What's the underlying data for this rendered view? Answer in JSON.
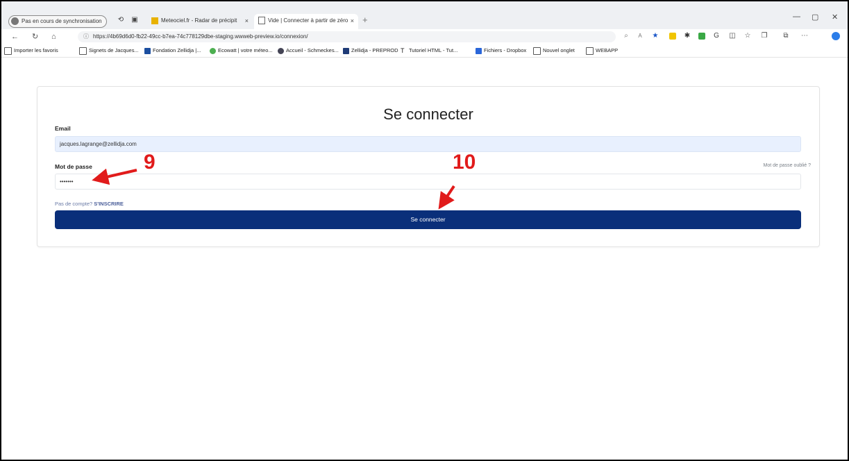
{
  "browser": {
    "profile_label": "Pas en cours de synchronisation",
    "tabs": [
      {
        "title": "Meteociel.fr - Radar de précipit",
        "active": false
      },
      {
        "title": "Vide | Connecter à partir de zéro",
        "active": true
      }
    ],
    "new_tab_symbol": "+",
    "close_symbol": "×",
    "window_controls": [
      "—",
      "▢",
      "✕"
    ],
    "url": "https://4b69d6d0-fb22-49cc-b7ea-74c778129dbe-staging.wwweb-preview.io/connexion/",
    "favorites": [
      {
        "label": "Importer les favoris",
        "icon": "import-icon"
      },
      {
        "label": "Signets de Jacques...",
        "icon": "page-icon"
      },
      {
        "label": "Fondation Zellidja |...",
        "icon": "site-icon"
      },
      {
        "label": "Ecowatt | votre méteo...",
        "icon": "ecowatt-icon"
      },
      {
        "label": "Accueil - Schmeckes...",
        "icon": "wordpress-icon"
      },
      {
        "label": "Zellidja - PREPROD",
        "icon": "zellidja-icon"
      },
      {
        "label": "Tutoriel HTML - Tut...",
        "icon": "tutorial-icon"
      },
      {
        "label": "Fichiers - Dropbox",
        "icon": "dropbox-icon"
      },
      {
        "label": "Nouvel onglet",
        "icon": "newtab-icon"
      },
      {
        "label": "WEBAPP",
        "icon": "page-icon"
      }
    ]
  },
  "login": {
    "title": "Se connecter",
    "email_label": "Email",
    "email_value": "jacques.lagrange@zellidja.com",
    "password_label": "Mot de passe",
    "password_value": "•••••••",
    "forgot_label": "Mot de passe oublié ?",
    "signup_prefix": "Pas de compte?",
    "signup_link": "S'INSCRIRE",
    "submit_label": "Se connecter"
  },
  "annotations": {
    "step_9": "9",
    "step_10": "10"
  },
  "colors": {
    "annotation": "#e11b1b",
    "button": "#0a2f7a",
    "email_autofill": "#e8f0fe"
  }
}
